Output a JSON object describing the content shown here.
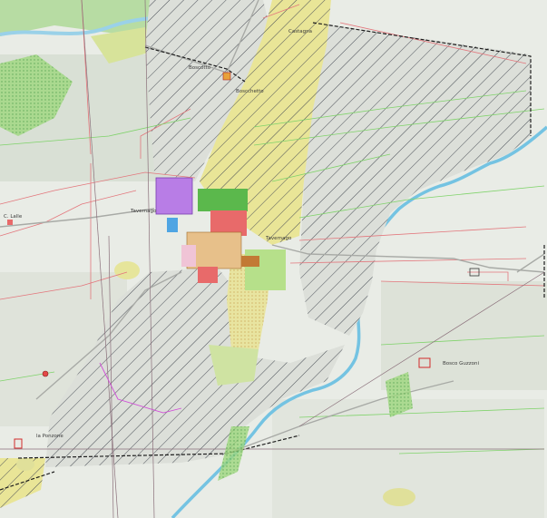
{
  "map": {
    "colors": {
      "background": "#e9ece6",
      "hatch": "#4a4f57",
      "hatch_fill": "#d9dcd6",
      "yellow_zone": "#e9e597",
      "violet_zone": "#b87de6",
      "blue_building": "#4fa5e3",
      "red_building": "#e86a6a",
      "tan_building": "#e7c08a",
      "green_zone": "#5bb84c",
      "light_green": "#b6e08a",
      "river": "#74c3e2",
      "parcel_red": "#e3767c",
      "contour_green": "#7fd36a",
      "road_grey": "#a8aaa6"
    },
    "labels": {
      "top_farm": "Castagna",
      "north_farm": "Boscotto",
      "north_farm_detail": "Boscchetto",
      "west_locality": "C. Lalle",
      "center_left": "Tavernago",
      "center_right": "Tavernago",
      "east_farm": "Bosco Guzzoni",
      "southwest_farm": "la Ponzone"
    },
    "icons": {
      "marker": "red-circle-marker-icon"
    }
  }
}
